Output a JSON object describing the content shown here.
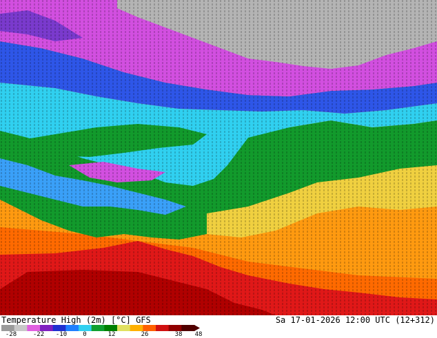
{
  "map": {
    "title": "Temperature High (2m) [°C] GFS",
    "valid_time": "Sa 17-01-2026 12:00 UTC (12+312)"
  },
  "legend": {
    "ticks": [
      "-28",
      "-22",
      "-10",
      "0",
      "12",
      "26",
      "38",
      "48"
    ],
    "colors": [
      "#9a9a9a",
      "#c8c8c8",
      "#e060e0",
      "#8020c0",
      "#2030d0",
      "#2080ff",
      "#30d0f0",
      "#10a030",
      "#008000",
      "#e0e060",
      "#ffb000",
      "#ff6000",
      "#d01010",
      "#900000",
      "#500000"
    ]
  },
  "colors": {
    "grey": "#b4b4b4",
    "magenta": "#d24fe0",
    "purple": "#7a3acd",
    "blue": "#2e56e8",
    "light_blue": "#3aa0f8",
    "cyan": "#30d0f0",
    "green": "#129a2c",
    "yellow": "#f0d040",
    "orange": "#ff9a10",
    "deep_orange": "#ff6a00",
    "red": "#e01818",
    "dark_red": "#b00000"
  }
}
